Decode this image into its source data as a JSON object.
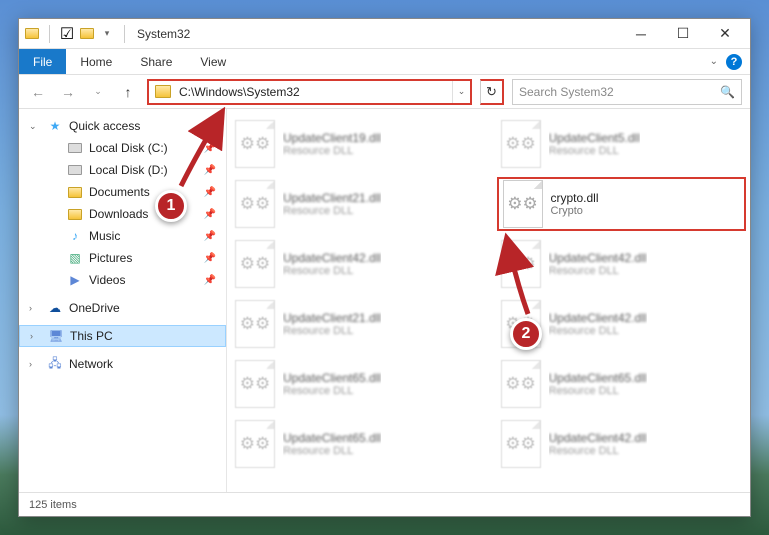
{
  "window": {
    "title": "System32"
  },
  "ribbon": {
    "file": "File",
    "home": "Home",
    "share": "Share",
    "view": "View"
  },
  "address": {
    "path": "C:\\Windows\\System32"
  },
  "search": {
    "placeholder": "Search System32"
  },
  "sidebar": {
    "quick_access": "Quick access",
    "items": [
      {
        "label": "Local Disk (C:)"
      },
      {
        "label": "Local Disk (D:)"
      },
      {
        "label": "Documents"
      },
      {
        "label": "Downloads"
      },
      {
        "label": "Music"
      },
      {
        "label": "Pictures"
      },
      {
        "label": "Videos"
      }
    ],
    "onedrive": "OneDrive",
    "this_pc": "This PC",
    "network": "Network"
  },
  "files": [
    {
      "name": "UpdateClient19.dll",
      "desc": "Resource DLL",
      "blurred": true
    },
    {
      "name": "UpdateClient5.dll",
      "desc": "Resource DLL",
      "blurred": true
    },
    {
      "name": "UpdateClient21.dll",
      "desc": "Resource DLL",
      "blurred": true
    },
    {
      "name": "crypto.dll",
      "desc": "Crypto",
      "blurred": false,
      "highlighted": true
    },
    {
      "name": "UpdateClient42.dll",
      "desc": "Resource DLL",
      "blurred": true
    },
    {
      "name": "UpdateClient42.dll",
      "desc": "Resource DLL",
      "blurred": true
    },
    {
      "name": "UpdateClient21.dll",
      "desc": "Resource DLL",
      "blurred": true
    },
    {
      "name": "UpdateClient42.dll",
      "desc": "Resource DLL",
      "blurred": true
    },
    {
      "name": "UpdateClient65.dll",
      "desc": "Resource DLL",
      "blurred": true
    },
    {
      "name": "UpdateClient65.dll",
      "desc": "Resource DLL",
      "blurred": true
    },
    {
      "name": "UpdateClient65.dll",
      "desc": "Resource DLL",
      "blurred": true
    },
    {
      "name": "UpdateClient42.dll",
      "desc": "Resource DLL",
      "blurred": true
    }
  ],
  "status": {
    "count": "125 items"
  },
  "callouts": {
    "one": "1",
    "two": "2"
  }
}
